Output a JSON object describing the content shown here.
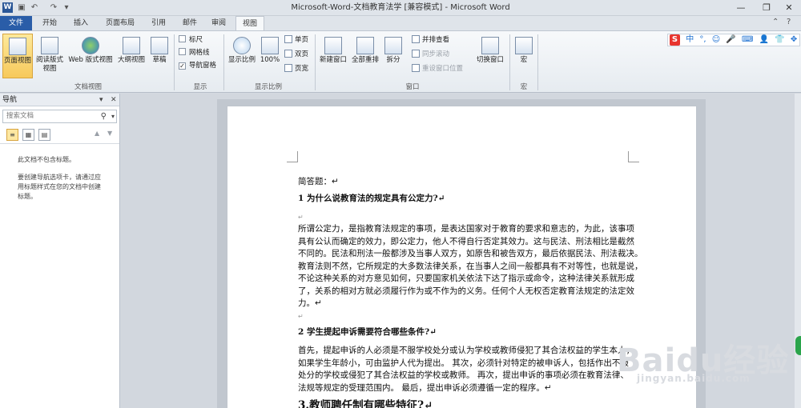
{
  "window": {
    "title": "Microsoft-Word-文档教育法学 [兼容模式] - Microsoft Word",
    "app_icon_label": "W",
    "minimize": "—",
    "restore": "❐",
    "close": "✕"
  },
  "ribbon_tabs": [
    "文件",
    "开始",
    "插入",
    "页面布局",
    "引用",
    "邮件",
    "审阅",
    "视图"
  ],
  "active_tab": "视图",
  "ribbon": {
    "doc_views": {
      "group_label": "文档视图",
      "buttons": [
        "页面视图",
        "阅读版式\n视图",
        "Web 版式视图",
        "大纲视图",
        "草稿"
      ]
    },
    "show": {
      "group_label": "显示",
      "ruler": "标尺",
      "gridlines": "网格线",
      "nav_pane": "导航窗格",
      "nav_pane_checked": true
    },
    "zoom": {
      "group_label": "显示比例",
      "zoom_button": "显示比例",
      "percent_button": "100%",
      "one_page": "单页",
      "two_pages": "双页",
      "page_width": "页宽"
    },
    "window_group": {
      "group_label": "窗口",
      "new_window": "新建窗口",
      "arrange_all": "全部重排",
      "split": "拆分",
      "side_by_side": "并排查看",
      "sync_scroll": "同步滚动",
      "reset_pos": "重设窗口位置",
      "switch_windows": "切换窗口"
    },
    "macros": {
      "group_label": "宏",
      "macro_button": "宏"
    }
  },
  "ime_bar": {
    "logo": "S",
    "lang": "中",
    "icons": [
      "°,",
      "☺",
      "🎤",
      "⌨",
      "👤",
      "👕",
      "✥"
    ]
  },
  "nav_pane": {
    "title": "导航",
    "search_placeholder": "搜索文档",
    "message_1": "此文档不包含标题。",
    "message_2": "要创建导航选项卡，请通过应用标题样式在您的文档中创建标题。"
  },
  "document": {
    "lines": [
      {
        "type": "text",
        "text": "简答题：↵"
      },
      {
        "type": "heading",
        "text": "1 为什么说教育法的规定具有公定力?↵"
      },
      {
        "type": "mark",
        "text": "↵"
      },
      {
        "type": "text",
        "text": "所谓公定力，是指教育法规定的事项，是表达国家对于教育的要求和意志的，为此，该事项"
      },
      {
        "type": "text",
        "text": "具有公认而确定的效力，即公定力，他人不得自行否定其效力。这与民法、刑法相比是截然"
      },
      {
        "type": "text",
        "text": "不同的。民法和刑法一般都涉及当事人双方，如原告和被告双方，最后依据民法、刑法裁决。"
      },
      {
        "type": "text",
        "text": "教育法则不然，它所规定的大多数法律关系，在当事人之间一般都具有不对等性，也就是说，"
      },
      {
        "type": "text",
        "text": "不论这种关系的对方意见如何，只要国家机关依法下达了指示或命令，这种法律关系就形成"
      },
      {
        "type": "text",
        "text": "了，关系的相对方就必须履行作为或不作为的义务。任何个人无权否定教育法规定的法定效"
      },
      {
        "type": "text",
        "text": "力。↵"
      },
      {
        "type": "mark",
        "text": "↵"
      },
      {
        "type": "heading",
        "text": "2 学生提起申诉需要符合哪些条件?↵"
      },
      {
        "type": "text",
        "text": "首先，提起申诉的人必须是不服学校处分或认为学校或教师侵犯了其合法权益的学生本人，"
      },
      {
        "type": "text",
        "text": "如果学生年龄小，可由监护人代为提出。 其次，必须针对特定的被申诉人，包括作出不服"
      },
      {
        "type": "text",
        "text": "处分的学校或侵犯了其合法权益的学校或教师。 再次，提出申诉的事项必须在教育法律、"
      },
      {
        "type": "text",
        "text": "法规等规定的受理范围内。 最后，提出申诉必须遵循一定的程序。↵"
      },
      {
        "type": "heading-big",
        "text": "3.教师聘任制有哪些特征?↵"
      }
    ]
  },
  "watermark": {
    "main": "Baidu经验",
    "sub": "jingyan.baidu.com"
  }
}
